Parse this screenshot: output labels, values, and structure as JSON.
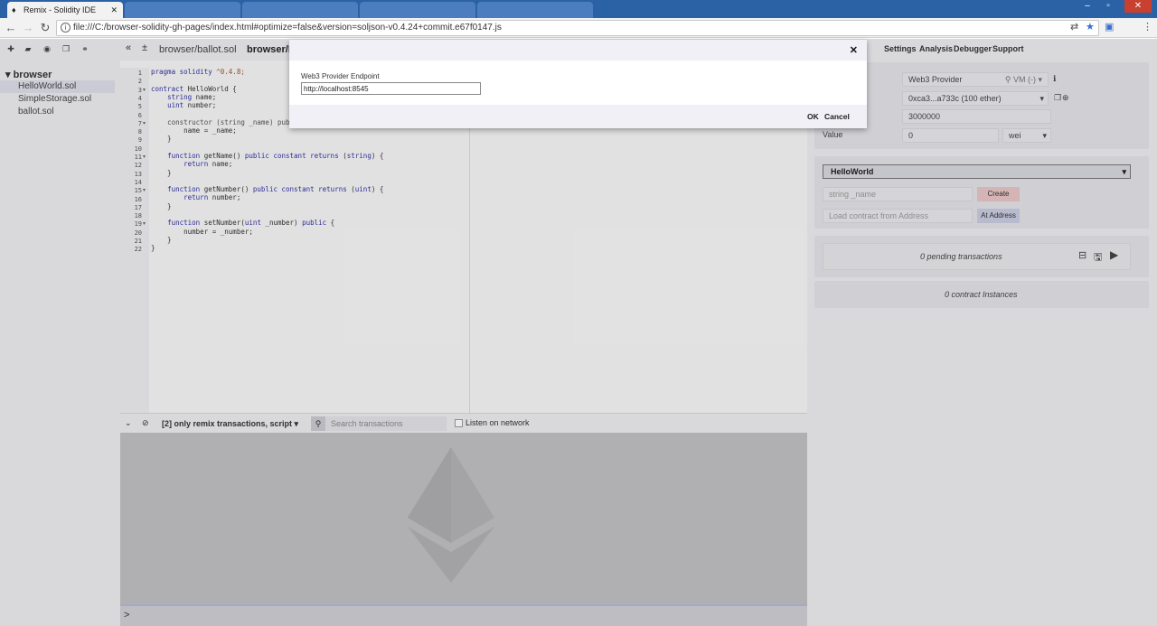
{
  "browser": {
    "tabs": [
      {
        "label": "Remix - Solidity IDE",
        "active": true
      },
      {
        "label": "",
        "active": false
      },
      {
        "label": "",
        "active": false
      },
      {
        "label": "",
        "active": false
      },
      {
        "label": "",
        "active": false
      }
    ],
    "url": "file:///C:/browser-solidity-gh-pages/index.html#optimize=false&version=soljson-v0.4.24+commit.e67f0147.js"
  },
  "file_explorer": {
    "root": "browser",
    "files": [
      "HelloWorld.sol",
      "SimpleStorage.sol",
      "ballot.sol"
    ]
  },
  "editor": {
    "tabs": [
      "browser/ballot.sol",
      "browser/H"
    ],
    "line_numbers": [
      "1",
      "2",
      "3",
      "4",
      "5",
      "6",
      "7",
      "8",
      "9",
      "10",
      "11",
      "12",
      "13",
      "14",
      "15",
      "16",
      "17",
      "18",
      "19",
      "20",
      "21",
      "22"
    ]
  },
  "terminal": {
    "filter": "[2] only remix transactions, script",
    "search_placeholder": "Search transactions",
    "listen_label": "Listen on network",
    "prompt": ">"
  },
  "right_panel": {
    "menu": [
      "Settings",
      "Analysis",
      "Debugger",
      "Support"
    ],
    "environment": "Web3 Provider",
    "env_suffix": "VM (-)",
    "account": "0xca3...a733c (100 ether)",
    "gas_limit": "3000000",
    "value_label": "Value",
    "value": "0",
    "value_unit": "wei",
    "contract": "HelloWorld",
    "create_placeholder": "string _name",
    "create_button": "Create",
    "address_placeholder": "Load contract from Address",
    "at_address_button": "At Address",
    "pending": "0 pending transactions",
    "instances": "0 contract Instances"
  },
  "modal": {
    "label": "Web3 Provider Endpoint",
    "input_value": "http://localhost:8545",
    "ok": "OK",
    "cancel": "Cancel"
  }
}
